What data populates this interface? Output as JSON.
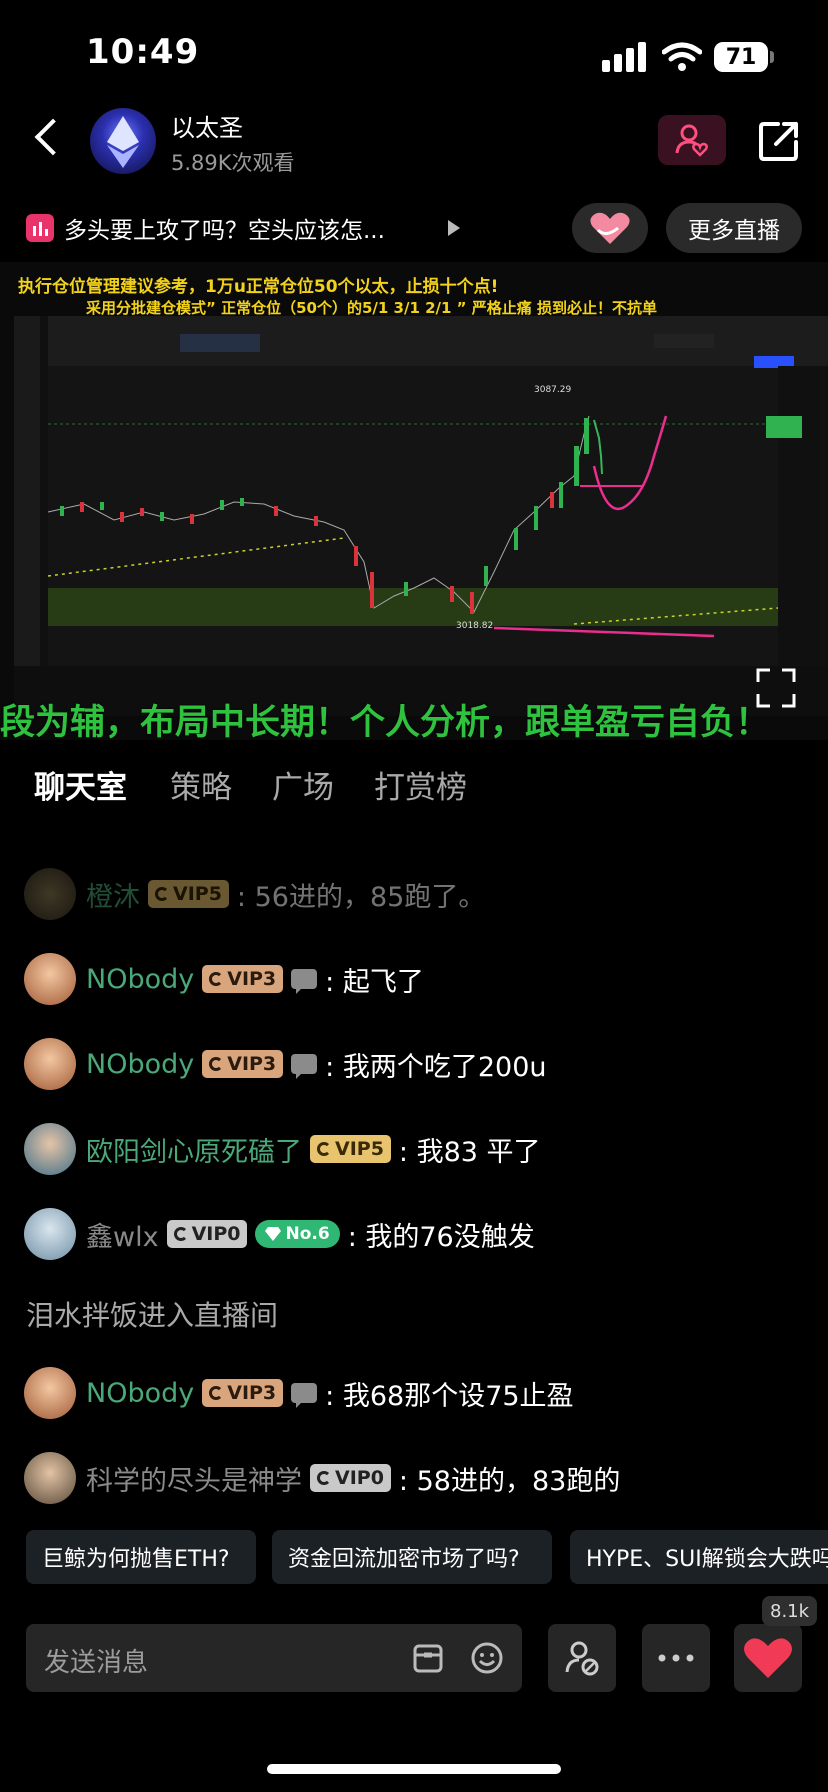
{
  "status": {
    "time": "10:49",
    "battery": "71"
  },
  "header": {
    "title": "以太圣",
    "views": "5.89K次观看"
  },
  "live_bar": {
    "topic": "多头要上攻了吗？空头应该怎...",
    "more_live": "更多直播"
  },
  "video": {
    "line1": "执行仓位管理建议参考，1万u正常仓位50个以太，止损十个点!",
    "line2": "采用分批建仓模式” 正常仓位（50个）的5/1  3/1  2/1 ” 严格止痛 损到必止！不抗单",
    "marquee": "段为辅，布局中长期！个人分析，跟单盈亏自负！",
    "chart_labels": {
      "high": "3087.29",
      "low": "3018.82"
    }
  },
  "tabs": [
    "聊天室",
    "策略",
    "广场",
    "打赏榜"
  ],
  "chat": [
    {
      "user": "橙沐",
      "vip": "VIP5",
      "text": ": 56进的，85跑了。"
    },
    {
      "user": "NObody",
      "vip": "VIP3",
      "text": ": 起飞了"
    },
    {
      "user": "NObody",
      "vip": "VIP3",
      "text": ": 我两个吃了200u"
    },
    {
      "user": "欧阳剑心原死磕了",
      "vip": "VIP5",
      "text": ": 我83  平了"
    },
    {
      "user": "鑫wlx",
      "vip": "VIP0",
      "badge": "No.6",
      "text": ": 我的76没触发"
    },
    {
      "user": "NObody",
      "vip": "VIP3",
      "text": ": 我68那个设75止盈"
    },
    {
      "user": "科学的尽头是神学",
      "vip": "VIP0",
      "text": ": 58进的，83跑的"
    }
  ],
  "system_message": "泪水拌饭进入直播间",
  "suggestions": [
    "巨鲸为何抛售ETH?",
    "资金回流加密市场了吗?",
    "HYPE、SUI解锁会大跌吗"
  ],
  "input": {
    "placeholder": "发送消息"
  },
  "likes": "8.1k",
  "colors": {
    "username": "#4aa879",
    "vip3": "#d9a57c",
    "vip5": "#e9c46f",
    "vip0": "#c9c9c9",
    "heart": "#f03a56"
  }
}
